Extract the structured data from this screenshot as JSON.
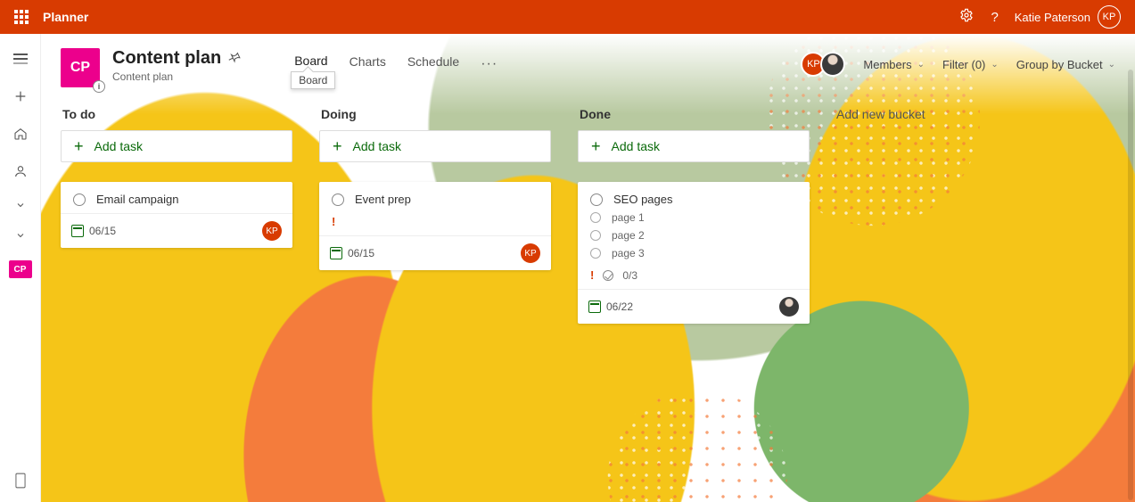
{
  "topbar": {
    "app_name": "Planner",
    "user_name": "Katie Paterson",
    "user_initials": "KP"
  },
  "rail": {
    "cp_label": "CP"
  },
  "plan": {
    "tile_initials": "CP",
    "title": "Content plan",
    "subtitle": "Content plan",
    "info_badge": "i"
  },
  "tabs": {
    "board": "Board",
    "charts": "Charts",
    "schedule": "Schedule",
    "tooltip": "Board"
  },
  "toolbar": {
    "members": "Members",
    "filter": "Filter (0)",
    "group_by": "Group by Bucket"
  },
  "buckets": {
    "todo": {
      "title": "To do",
      "add_label": "Add task",
      "cards": [
        {
          "title": "Email campaign",
          "date": "06/15",
          "assignee": "KP"
        }
      ]
    },
    "doing": {
      "title": "Doing",
      "add_label": "Add task",
      "cards": [
        {
          "title": "Event prep",
          "date": "06/15",
          "assignee": "KP",
          "priority": "!"
        }
      ]
    },
    "done": {
      "title": "Done",
      "add_label": "Add task",
      "cards": [
        {
          "title": "SEO pages",
          "subtasks": [
            "page 1",
            "page 2",
            "page 3"
          ],
          "progress": "0/3",
          "priority": "!",
          "date": "06/22",
          "assignee": "photo"
        }
      ]
    },
    "new": {
      "title": "Add new bucket"
    }
  }
}
